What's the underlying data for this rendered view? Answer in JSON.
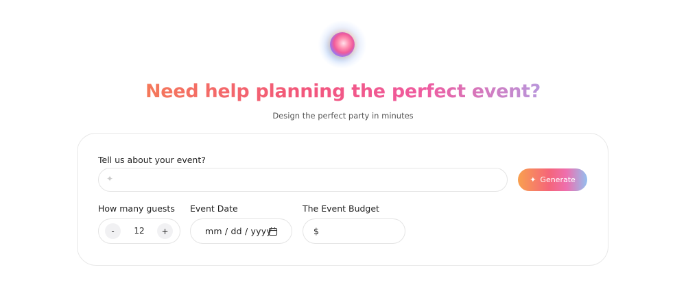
{
  "hero": {
    "orb_icon": "gradient-orb-icon",
    "title": "Need help planning the perfect event?",
    "subtitle": "Design the perfect party in minutes",
    "gradient_colors": [
      "#f6a24a",
      "#f2567d",
      "#ef5ca0",
      "#b59ae0",
      "#7cc6f2"
    ]
  },
  "form": {
    "prompt_label": "Tell us about your event?",
    "prompt_value": "",
    "prompt_icon": "sparkle-icon",
    "generate_icon": "sparkle-icon",
    "generate_label": "Generate",
    "guests_label": "How many guests",
    "guests_minus": "-",
    "guests_value": "12",
    "guests_plus": "+",
    "date_label": "Event Date",
    "date_placeholder": "mm / dd / yyyy",
    "date_icon": "calendar-icon",
    "budget_label": "The Event Budget",
    "budget_symbol": "$",
    "budget_value": ""
  }
}
